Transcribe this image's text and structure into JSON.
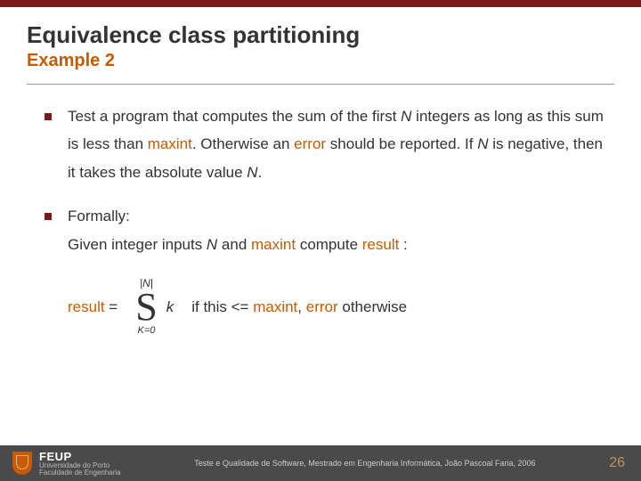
{
  "header": {
    "title": "Equivalence class partitioning",
    "subtitle": "Example 2"
  },
  "bullets": {
    "b1": {
      "pre": "Test a program that computes the sum of the first ",
      "N": "N",
      "mid1": " integers as long as this sum is less than ",
      "maxint": "maxint",
      "mid2": ".   Otherwise an ",
      "error": "error",
      "mid3": " should be reported. If ",
      "N2": "N",
      "mid4": " is negative, then it takes the absolute value ",
      "N3": "N",
      "end": "."
    },
    "b2": {
      "line1": "Formally:",
      "pre": "Given integer inputs  ",
      "N": "N",
      "mid1": " and ",
      "maxint": "maxint",
      "mid2": "  compute ",
      "result": "result",
      "end": " :"
    }
  },
  "formula": {
    "lhs_var": "result",
    "lhs_eq": "  =",
    "upper": "|N|",
    "sigma": "S",
    "lower": "K=0",
    "k": "k",
    "if": "if  this  <=  ",
    "maxint": "maxint",
    "comma": ",   ",
    "error": "error",
    "otherwise": " otherwise"
  },
  "footer": {
    "logo_main": "FEUP",
    "logo_sub1": "Universidade do Porto",
    "logo_sub2": "Faculdade de Engenharia",
    "center": "Teste e Qualidade de Software, Mestrado em Engenharia Informática, João Pascoal Faria, 2006",
    "page": "26"
  }
}
